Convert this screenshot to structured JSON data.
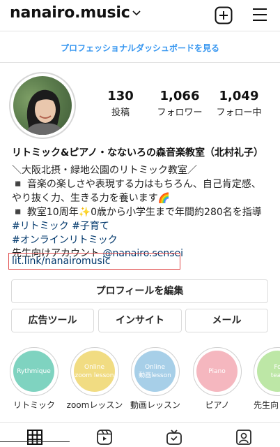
{
  "header": {
    "username": "nanairo.music"
  },
  "dashboard_link": "プロフェッショナルダッシュボードを見る",
  "stats": [
    {
      "value": "130",
      "label": "投稿"
    },
    {
      "value": "1,066",
      "label": "フォロワー"
    },
    {
      "value": "1,049",
      "label": "フォロー中"
    }
  ],
  "bio": {
    "name": "リトミック&ピアノ・なないろの森音楽教室（北村礼子）",
    "line1": "＼大阪北摂・緑地公園のリトミック教室／",
    "line2": "◾️ 音楽の楽しさや表現する力はもちろん、自己肯定感、",
    "line3": "やり抜く力、生きる力を養います🌈",
    "line4a": "◾️ 教室10周年",
    "line4b": "0歳から小学生まで年間約280名を指導",
    "hashtag1": "#リトミック",
    "hashtag2": "#子育て",
    "hashtag3": "#オンラインリトミック",
    "teacher_text": "先生向けアカウント ",
    "teacher_handle": "@nanairo.sensei",
    "link": "lit.link/nanairomusic"
  },
  "buttons": {
    "edit_profile": "プロフィールを編集",
    "ad_tools": "広告ツール",
    "insights": "インサイト",
    "email": "メール"
  },
  "highlights": [
    {
      "cover_text": "Rythmique",
      "label": "リトミック",
      "color": "#7fd3c0"
    },
    {
      "cover_text": "Online\nzoom lesson",
      "label": "zoomレッスン",
      "color": "#f1dc82"
    },
    {
      "cover_text": "Online\n動画lesson",
      "label": "動画レッスン",
      "color": "#a7cfe8"
    },
    {
      "cover_text": "Piano",
      "label": "ピアノ",
      "color": "#f5b7bf"
    },
    {
      "cover_text": "Fo\nteac",
      "label": "先生向",
      "color": "#bde7a6"
    }
  ],
  "icons": {
    "header": [
      "chevron-down-icon",
      "new-post-icon",
      "menu-icon"
    ],
    "tabs": [
      "grid-icon",
      "reels-icon",
      "igtv-icon",
      "tagged-icon"
    ]
  }
}
